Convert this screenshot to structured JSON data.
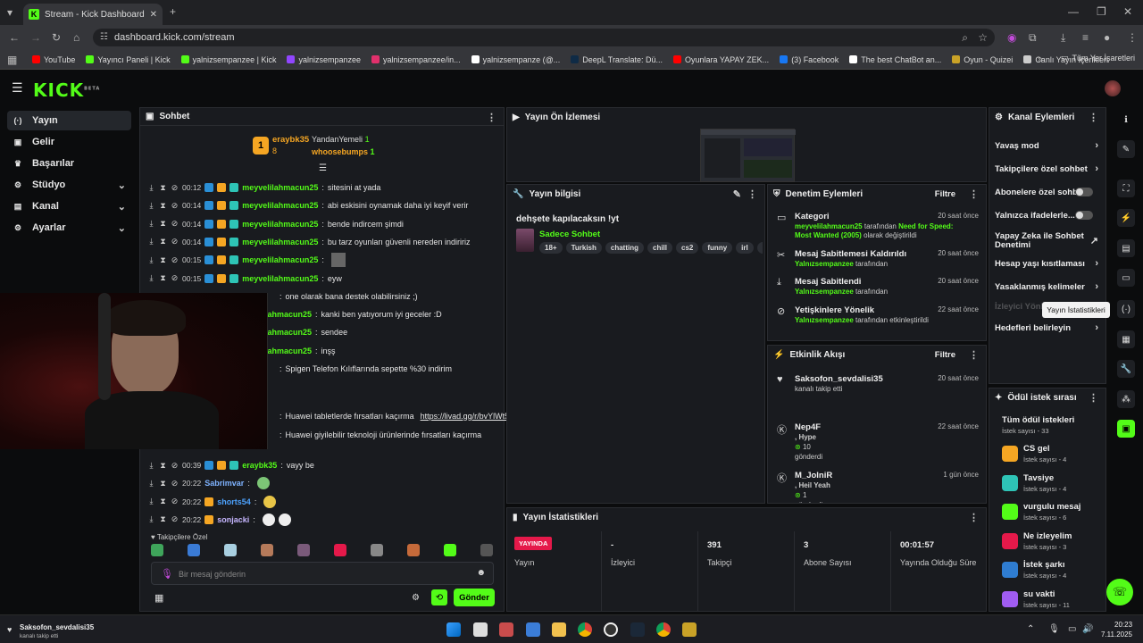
{
  "browser": {
    "tab_title": "Stream - Kick Dashboard",
    "url": "dashboard.kick.com/stream",
    "bookmarks": [
      {
        "label": "YouTube",
        "color": "#ff0000"
      },
      {
        "label": "Yayıncı Paneli | Kick",
        "color": "#53fc18"
      },
      {
        "label": "yalnizsempanzee | Kick",
        "color": "#53fc18"
      },
      {
        "label": "yalnizsempanzee",
        "color": "#9146ff"
      },
      {
        "label": "yalnizsempanzee/in...",
        "color": "#e1306c"
      },
      {
        "label": "yalnizsempanze (@...",
        "color": "#ffffff"
      },
      {
        "label": "DeepL Translate: Dü...",
        "color": "#0f2b46"
      },
      {
        "label": "Oyunlara YAPAY ZEK...",
        "color": "#ff0000"
      },
      {
        "label": "(3) Facebook",
        "color": "#1877f2"
      },
      {
        "label": "The best ChatBot an...",
        "color": "#ffffff"
      },
      {
        "label": "Oyun - Quizei",
        "color": "#c9a227"
      },
      {
        "label": "Canlı Yayın İçerikleri",
        "color": "#cccccc"
      }
    ],
    "all_bookmarks": "Tüm Yer İşaretleri"
  },
  "brand": {
    "logo": "KICK",
    "beta": "BETA",
    "accent": "#53fc18"
  },
  "sidebar": {
    "items": [
      {
        "label": "Yayın",
        "icon": "broadcast-icon"
      },
      {
        "label": "Gelir",
        "icon": "money-icon"
      },
      {
        "label": "Başarılar",
        "icon": "trophy-icon"
      },
      {
        "label": "Stüdyo",
        "icon": "studio-icon"
      },
      {
        "label": "Kanal",
        "icon": "channel-icon"
      },
      {
        "label": "Ayarlar",
        "icon": "gear-icon"
      }
    ]
  },
  "chat": {
    "title": "Sohbet",
    "top": {
      "rank1_name": "eraybk35",
      "rank1_count": "8",
      "rank2_name": "YandanYemeli",
      "rank2_count": "1",
      "rank3_name": "whoosebumps",
      "rank3_count": "1",
      "rank_badge": "1"
    },
    "messages": [
      {
        "time": "00:12",
        "user": "meyvelilahmacun25",
        "text": "sitesini at yada"
      },
      {
        "time": "00:14",
        "user": "meyvelilahmacun25",
        "text": "abi eskisini oynamak daha iyi keyif verir"
      },
      {
        "time": "00:14",
        "user": "meyvelilahmacun25",
        "text": "bende indircem şimdi"
      },
      {
        "time": "00:14",
        "user": "meyvelilahmacun25",
        "text": "bu tarz oyunları güvenli nereden indiririz"
      },
      {
        "time": "00:15",
        "user": "meyvelilahmacun25",
        "text": ""
      },
      {
        "time": "00:15",
        "user": "meyvelilahmacun25",
        "text": "eyw"
      }
    ],
    "hidden_lines": [
      {
        "text": "one olarak bana destek olabilirsiniz ;)"
      },
      {
        "user": "lahmacun25",
        "text": "kanki ben yatıyorum iyi geceler :D"
      },
      {
        "user": "lahmacun25",
        "text": "sendee"
      },
      {
        "user": "lahmacun25",
        "text": "inşş"
      },
      {
        "text": "Spigen Telefon Kılıflarında sepette %30 indirim"
      },
      {
        "text": "Huawei tabletlerde fırsatları kaçırma",
        "link": "https://livad.gg/r/bvYlWt5/"
      },
      {
        "text": "Huawei giyilebilir teknoloji ürünlerinde fırsatları kaçırma"
      }
    ],
    "bottom_messages": [
      {
        "time": "00:39",
        "user": "eraybk35",
        "text": "vayy be",
        "color": "#53fc18"
      },
      {
        "time": "20:22",
        "user": "Sabrimvar",
        "text": "",
        "color": "#7fb3ff"
      },
      {
        "time": "20:22",
        "user": "shorts54",
        "text": "",
        "color": "#4da3ff"
      },
      {
        "time": "20:22",
        "user": "sonjacki",
        "text": "",
        "color": "#c6b6ff"
      }
    ],
    "emote_section": "Takipçilere Özel",
    "input_placeholder": "Bir mesaj gönderin",
    "send_label": "Gönder"
  },
  "preview": {
    "title": "Yayın Ön İzlemesi"
  },
  "stream_info": {
    "title": "Yayın bilgisi",
    "stream_title": "dehşete kapılacaksın !yt",
    "category": "Sadece Sohbet",
    "tags": [
      "18+",
      "Turkish",
      "chatting",
      "chill",
      "cs2",
      "funny",
      "irl",
      "korku"
    ]
  },
  "mod_actions": {
    "title": "Denetim Eylemleri",
    "filter": "Filtre",
    "rows": [
      {
        "title": "Kategori",
        "user": "meyvelilahmacun25",
        "mid": "tarafından",
        "extra": "Need for Speed: Most Wanted (2005)",
        "tail": "olarak değiştirildi",
        "time": "20 saat önce",
        "icon": "category-icon"
      },
      {
        "title": "Mesaj Sabitlemesi Kaldırıldı",
        "user": "Yalnızsempanzee",
        "mid": "tarafından",
        "time": "20 saat önce",
        "icon": "unpin-icon"
      },
      {
        "title": "Mesaj Sabitlendi",
        "user": "Yalnızsempanzee",
        "mid": "tarafından",
        "time": "20 saat önce",
        "icon": "pin-icon"
      },
      {
        "title": "Yetişkinlere Yönelik",
        "user": "Yalnızsempanzee",
        "mid": "tarafından etkinleştirildi",
        "time": "22 saat önce",
        "icon": "adult-icon"
      }
    ]
  },
  "activity": {
    "title": "Etkinlik Akışı",
    "filter": "Filtre",
    "rows": [
      {
        "name": "Saksofon_sevdalisi35",
        "sub": "kanalı takip etti",
        "time": "20 saat önce"
      },
      {
        "name": "Nep4F",
        "sub": ", Hype",
        "amount": "10",
        "sent": "gönderdi",
        "time": "22 saat önce"
      },
      {
        "name": "M_JolniR",
        "sub": ", Heil Yeah",
        "amount": "1",
        "sent": "gönderdi",
        "time": "1 gün önce"
      }
    ]
  },
  "channel_actions": {
    "title": "Kanal Eylemleri",
    "items": [
      {
        "label": "Yavaş mod",
        "type": "arrow"
      },
      {
        "label": "Takipçilere özel sohbet",
        "type": "arrow"
      },
      {
        "label": "Abonelere özel sohbet",
        "type": "toggle"
      },
      {
        "label": "Yalnızca ifadelerle...",
        "type": "toggle"
      },
      {
        "label": "Yapay Zeka ile Sohbet Denetimi",
        "type": "external"
      },
      {
        "label": "Hesap yaşı kısıtlaması",
        "type": "arrow"
      },
      {
        "label": "Yasaklanmış kelimeler",
        "type": "arrow"
      },
      {
        "label": "İzleyici Yönlendir",
        "type": "faded"
      },
      {
        "label": "Hedefleri belirleyin",
        "type": "arrow"
      }
    ],
    "tooltip": "Yayın İstatistikleri"
  },
  "rewards": {
    "title": "Ödül istek sırası",
    "all_label": "Tüm ödül istekleri",
    "all_count": "İstek sayısı - 33",
    "items": [
      {
        "name": "CS gel",
        "count": "İstek sayısı - 4",
        "color": "#f5a623"
      },
      {
        "name": "Tavsiye",
        "count": "İstek sayısı - 4",
        "color": "#2ec4b6"
      },
      {
        "name": "vurgulu mesaj",
        "count": "İstek sayısı - 6",
        "color": "#53fc18"
      },
      {
        "name": "Ne izleyelim",
        "count": "İstek sayısı - 3",
        "color": "#e5194a"
      },
      {
        "name": "İstek şarkı",
        "count": "İstek sayısı - 4",
        "color": "#2f7dd1"
      },
      {
        "name": "su vakti",
        "count": "İstek sayısı - 11",
        "color": "#a05cf2"
      }
    ]
  },
  "stats": {
    "title": "Yayın İstatistikleri",
    "status": "YAYINDA",
    "status_label": "Yayın",
    "items": [
      {
        "value": "-",
        "label": "İzleyici"
      },
      {
        "value": "391",
        "label": "Takipçi"
      },
      {
        "value": "3",
        "label": "Abone Sayısı"
      },
      {
        "value": "00:01:57",
        "label": "Yayında Olduğu Süre"
      }
    ]
  },
  "taskbar": {
    "notif_name": "Saksofon_sevdalisi35",
    "notif_sub": "kanalı takip etti",
    "time": "20:23",
    "date": "7.11.2025"
  }
}
